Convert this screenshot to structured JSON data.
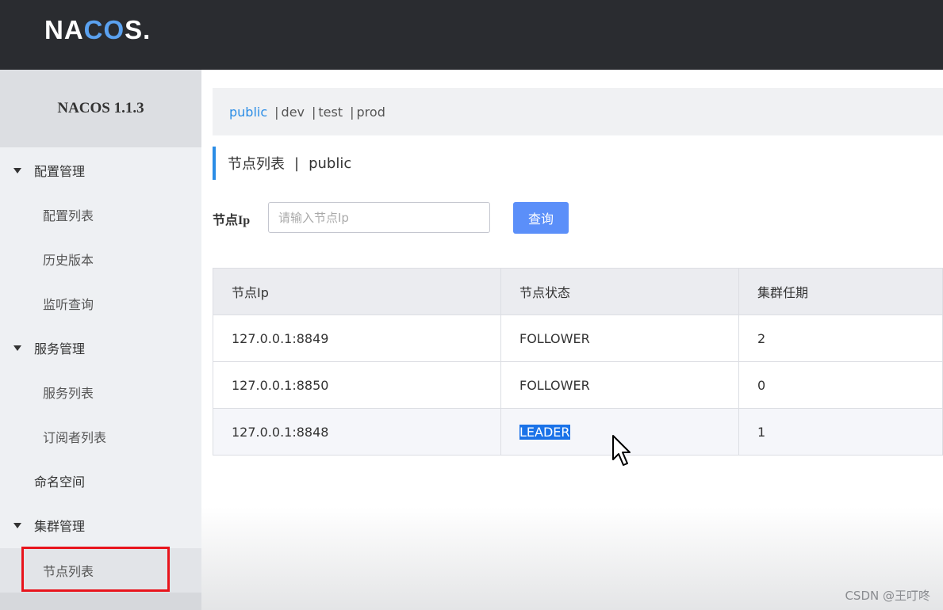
{
  "brand": {
    "logo_part1": "NA",
    "logo_part2": "CO",
    "logo_part3": "S."
  },
  "sidebar": {
    "version": "NACOS 1.1.3",
    "groups": [
      {
        "label": "配置管理",
        "items": [
          "配置列表",
          "历史版本",
          "监听查询"
        ]
      },
      {
        "label": "服务管理",
        "items": [
          "服务列表",
          "订阅者列表"
        ]
      },
      {
        "label": "命名空间"
      },
      {
        "label": "集群管理",
        "items": [
          "节点列表"
        ]
      }
    ],
    "active_item": "节点列表"
  },
  "namespaces": {
    "items": [
      "public",
      "dev",
      "test",
      "prod"
    ],
    "separator": "|",
    "active": "public"
  },
  "page": {
    "title": "节点列表",
    "separator": "|",
    "namespace": "public"
  },
  "search": {
    "label": "节点Ip",
    "placeholder": "请输入节点Ip",
    "button_label": "查询"
  },
  "table": {
    "columns": [
      "节点Ip",
      "节点状态",
      "集群任期"
    ],
    "rows": [
      [
        "127.0.0.1:8849",
        "FOLLOWER",
        "2"
      ],
      [
        "127.0.0.1:8850",
        "FOLLOWER",
        "0"
      ],
      [
        "127.0.0.1:8848",
        "LEADER",
        "1"
      ]
    ]
  },
  "watermark": "CSDN @王叮咚"
}
